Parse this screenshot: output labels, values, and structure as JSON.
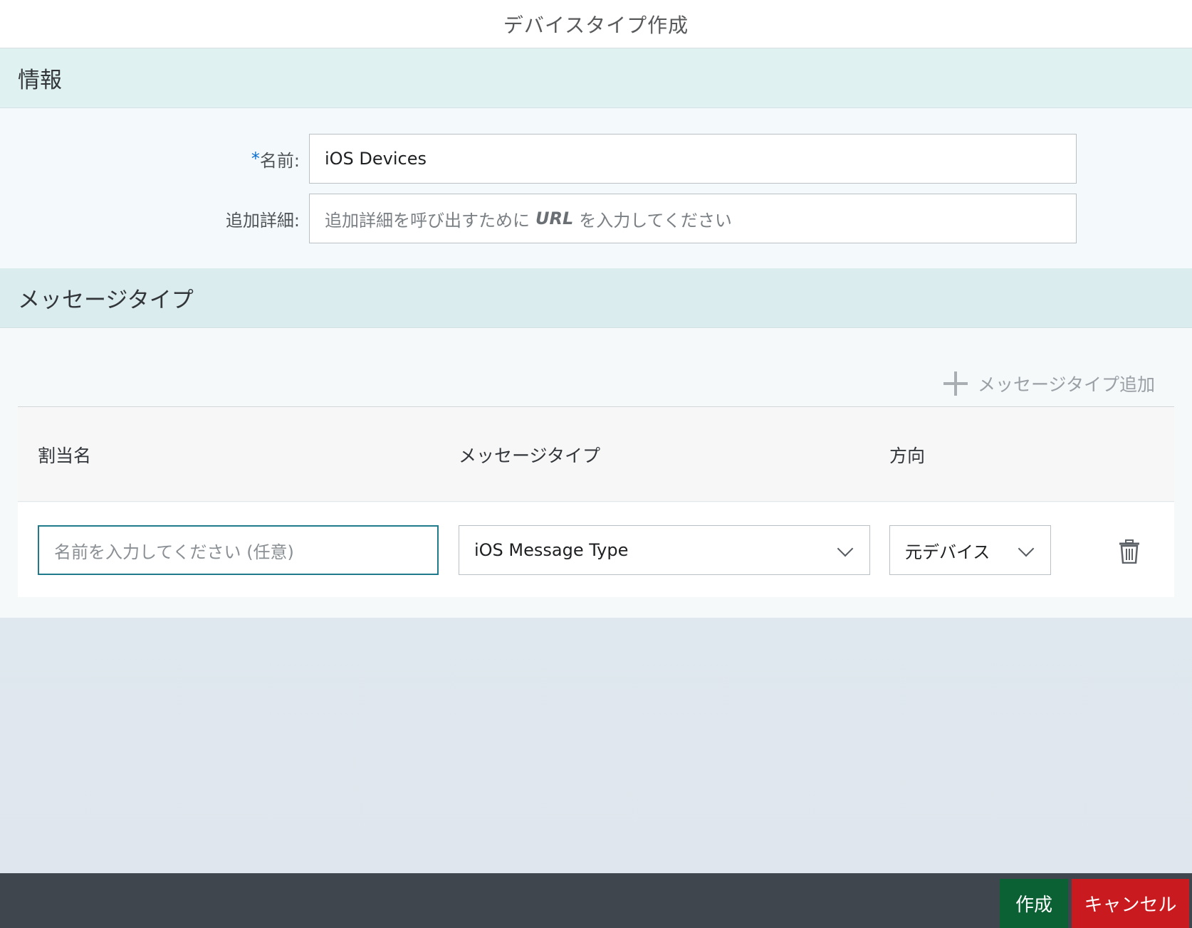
{
  "dialog": {
    "title": "デバイスタイプ作成"
  },
  "info_section": {
    "title": "情報",
    "name_field": {
      "required_mark": "*",
      "label": "名前:",
      "value": "iOS Devices"
    },
    "details_field": {
      "label": "追加詳細:",
      "placeholder_before": "追加詳細を呼び出すために",
      "placeholder_emphasis": "URL",
      "placeholder_after": "を入力してください"
    }
  },
  "message_type_section": {
    "title": "メッセージタイプ",
    "add_button_label": "メッセージタイプ追加",
    "add_icon": "plus-icon",
    "table": {
      "columns": [
        "割当名",
        "メッセージタイプ",
        "方向"
      ],
      "rows": [
        {
          "assigned_name_placeholder": "名前を入力してください (任意)",
          "message_type_value": "iOS Message Type",
          "direction_value": "元デバイス",
          "delete_icon": "trash-icon"
        }
      ]
    }
  },
  "footer": {
    "create_label": "作成",
    "cancel_label": "キャンセル"
  },
  "colors": {
    "create_button": "#0b6134",
    "cancel_button": "#c81a1f",
    "footer_bar": "#3f464d",
    "section_header": "#dff1f0"
  }
}
